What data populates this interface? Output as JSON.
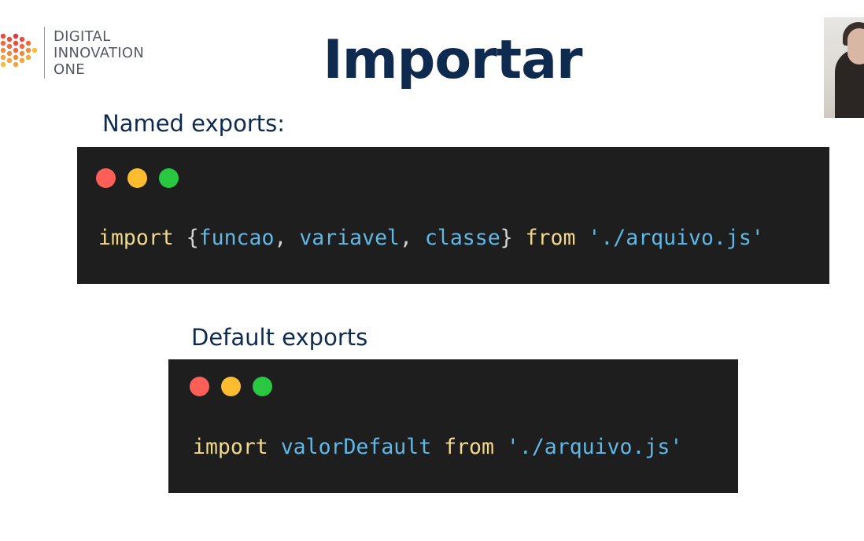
{
  "logo": {
    "line1": "DIGITAL",
    "line2": "INNOVATION",
    "line3": "ONE"
  },
  "title": "Importar",
  "sections": {
    "named": {
      "label": "Named exports:",
      "code": {
        "import_kw": "import",
        "open_brace": "{",
        "id1": "funcao",
        "comma1": ",",
        "id2": "variavel",
        "comma2": ",",
        "id3": "classe",
        "close_brace": "}",
        "from_kw": "from",
        "path": "'./arquivo.js'"
      }
    },
    "default": {
      "label": "Default exports",
      "code": {
        "import_kw": "import",
        "id": "valorDefault",
        "from_kw": "from",
        "path": "'./arquivo.js'"
      }
    }
  },
  "colors": {
    "title": "#0f2a4f",
    "code_bg": "#1e1e1e",
    "keyword": "#f2d98b",
    "identifier": "#5fb8e6",
    "dot_red": "#ff5f57",
    "dot_yellow": "#febc2e",
    "dot_green": "#28c840"
  },
  "icons": {
    "logo_mark": "dot-arrow-logo-icon",
    "window_controls": [
      "close-dot-icon",
      "minimize-dot-icon",
      "maximize-dot-icon"
    ]
  }
}
